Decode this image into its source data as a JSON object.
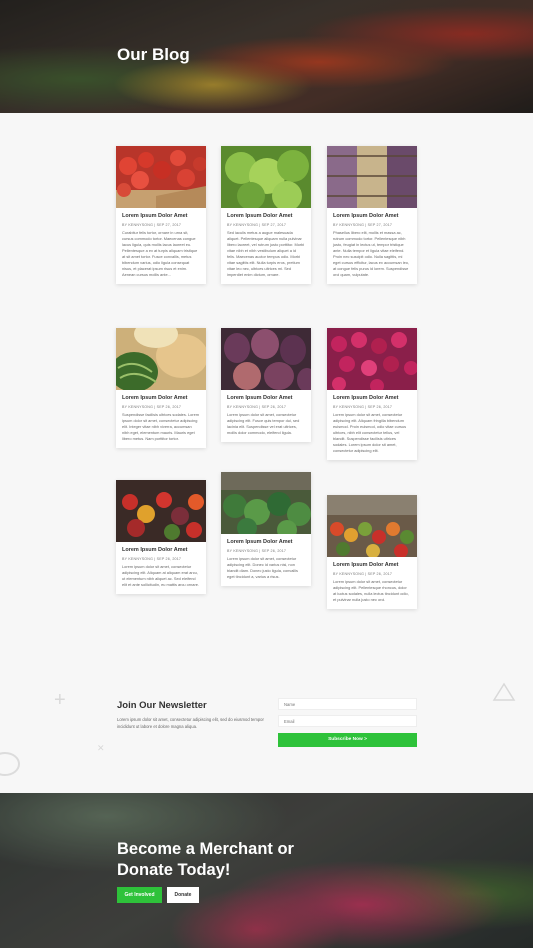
{
  "hero": {
    "title": "Our Blog"
  },
  "posts": [
    {
      "title": "Lorem Ipsum Dolor Amet",
      "meta": "BY KENNYSONG | SEP 27, 2017",
      "excerpt": "Curabitur felis tortor, ornare in urna sit, cursus commodo tortor. Maecenas congue lacus ligula, quis mollis lacus laoreet eu. Pellentesque a ex at turpis aliquam tristique at sit amet tortor. Fusce convallis, metus bibendum varius, odio ligula consequat nisus, et placerat ipsum risus et enim. Aenean cursus mollis ante...",
      "image": "tomatoes"
    },
    {
      "title": "Lorem Ipsum Dolor Amet",
      "meta": "BY KENNYSONG | SEP 27, 2017",
      "excerpt": "Sed iaculis metus a augue malesuada aliquet. Pellentesque aliquam nulla pulvinar libero laoreet, vel rutrum justo porttitor. Morbi vitae nibh et nibh vestibulum aliquet a id felis. Maecenas auctor tempus odio. Morbi vitae sagittis elit. Nulla turpis eros, pretium vitae leo nec, ultrices ultrices mi. Sed imperdiet enim dictum, ornare.",
      "image": "lettuce"
    },
    {
      "title": "Lorem Ipsum Dolor Amet",
      "meta": "BY KENNYSONG | SEP 27, 2017",
      "excerpt": "Phasellus libero elit, mollis et massa ac, rutrum commodo tortor. Pellentesque nibh justo, feugiat in lectus ut, tempor tristique ante. Nulla tempor et ligula vitae eleifend. Proin nec suscipit odio. Nulla sagittis, mi eget cursus efficitur, lacus ex accumsan leo, at congue felis purus id lorem. Suspendisse orci quam, vulputate.",
      "image": "beans"
    },
    {
      "title": "Lorem Ipsum Dolor Amet",
      "meta": "BY KENNYSONG | SEP 26, 2017",
      "excerpt": "Suspendisse facilisis ultrices sodales. Lorem ipsum dolor sit amet, consectetur adipiscing elit. Integer vitae nibh viverra, accumsan nibh eget, elementum mauris. Mauris eget libero metus. Nam porttitor tortor.",
      "image": "melons"
    },
    {
      "title": "Lorem Ipsum Dolor Amet",
      "meta": "BY KENNYSONG | SEP 26, 2017",
      "excerpt": "Lorem ipsum dolor sit amet, consectetur adipiscing elit. Fusce quis tempor dui, sed lacinia elit. Suspendisse vel erat ultrices, mollis dolor commodo, eleifend ligula.",
      "image": "figs"
    },
    {
      "title": "Lorem Ipsum Dolor Amet",
      "meta": "BY KENNYSONG | SEP 26, 2017",
      "excerpt": "Lorem ipsum dolor sit amet, consectetur adipiscing elit. Aliquam fringilla bibendum euismod. Proin euismod, odio vitae cursus ultrices, nibh elit consectetur tellus, vel blandit. Suspendisse facilisis ultrices sodales. Lorem ipsum dolor sit amet, consectetur adipiscing elit.",
      "image": "radishes"
    },
    {
      "title": "Lorem Ipsum Dolor Amet",
      "meta": "BY KENNYSONG | SEP 26, 2017",
      "excerpt": "Lorem ipsum dolor sit amet, consectetur adipiscing elit. Aliquam at aliquam erat arcu, ut elementum nibh aliquet ac. Sed eleifend elit et ante sollicitudin, eu mattis arcu ornare.",
      "image": "peppers"
    },
    {
      "title": "Lorem Ipsum Dolor Amet",
      "meta": "BY KENNYSONG | SEP 26, 2017",
      "excerpt": "Lorem ipsum dolor sit amet, consectetur adipiscing elit. Donec id varius nisi, non blandit diam. Donec justo ligula, convallis eget tincidunt a, varius a risus.",
      "image": "greens"
    },
    {
      "title": "Lorem Ipsum Dolor Amet",
      "meta": "BY KENNYSONG | SEP 26, 2017",
      "excerpt": "Lorem ipsum dolor sit amet, consectetur adipiscing elit. Pellentesque rhoncus, dolor at luctus sodales, nulla lectus tincidunt odio, et pulvinar nulla justo nec orci.",
      "image": "market"
    }
  ],
  "newsletter": {
    "title": "Join Our Newsletter",
    "text": "Lorem ipsum dolor sit amet, consectetur adipiscing elit, sed do eiusmod tempor incididunt ut labore et dolore magna aliqua.",
    "name_placeholder": "Name",
    "email_placeholder": "Email",
    "button_label": "Subscribe Now  >"
  },
  "cta": {
    "title": "Become a Merchant or Donate Today!",
    "primary_label": "Get Involved",
    "secondary_label": "Donate"
  },
  "colors": {
    "accent": "#2ec23a",
    "page_bg": "#f7f7f7"
  }
}
